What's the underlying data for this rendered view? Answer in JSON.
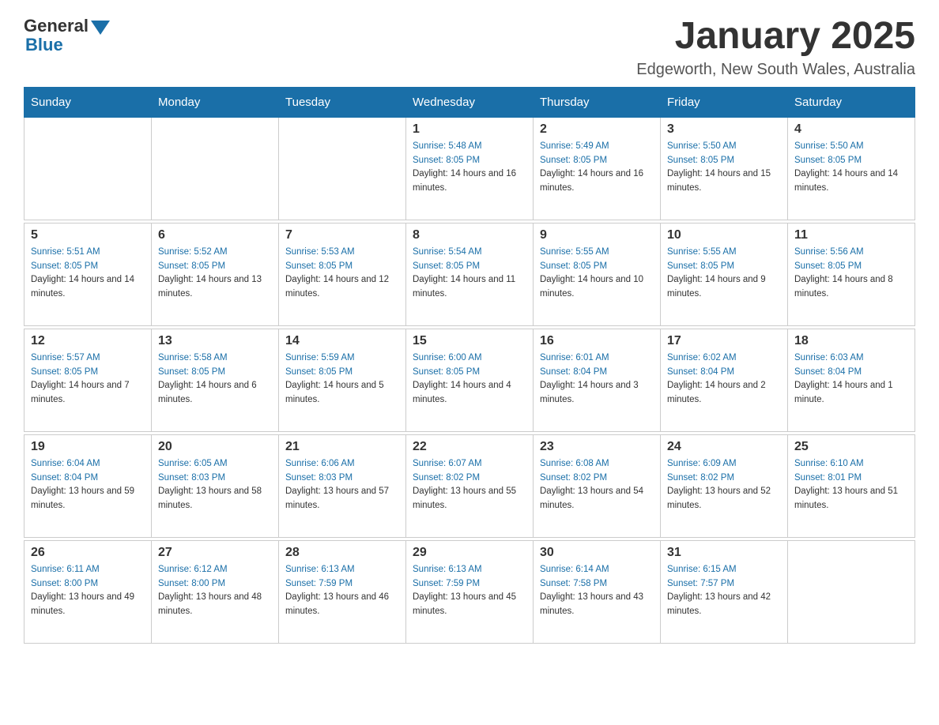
{
  "header": {
    "logo_text": "General",
    "logo_blue": "Blue",
    "month_title": "January 2025",
    "location": "Edgeworth, New South Wales, Australia"
  },
  "days_of_week": [
    "Sunday",
    "Monday",
    "Tuesday",
    "Wednesday",
    "Thursday",
    "Friday",
    "Saturday"
  ],
  "weeks": [
    {
      "days": [
        {
          "num": "",
          "info": ""
        },
        {
          "num": "",
          "info": ""
        },
        {
          "num": "",
          "info": ""
        },
        {
          "num": "1",
          "sunrise": "Sunrise: 5:48 AM",
          "sunset": "Sunset: 8:05 PM",
          "daylight": "Daylight: 14 hours and 16 minutes."
        },
        {
          "num": "2",
          "sunrise": "Sunrise: 5:49 AM",
          "sunset": "Sunset: 8:05 PM",
          "daylight": "Daylight: 14 hours and 16 minutes."
        },
        {
          "num": "3",
          "sunrise": "Sunrise: 5:50 AM",
          "sunset": "Sunset: 8:05 PM",
          "daylight": "Daylight: 14 hours and 15 minutes."
        },
        {
          "num": "4",
          "sunrise": "Sunrise: 5:50 AM",
          "sunset": "Sunset: 8:05 PM",
          "daylight": "Daylight: 14 hours and 14 minutes."
        }
      ]
    },
    {
      "days": [
        {
          "num": "5",
          "sunrise": "Sunrise: 5:51 AM",
          "sunset": "Sunset: 8:05 PM",
          "daylight": "Daylight: 14 hours and 14 minutes."
        },
        {
          "num": "6",
          "sunrise": "Sunrise: 5:52 AM",
          "sunset": "Sunset: 8:05 PM",
          "daylight": "Daylight: 14 hours and 13 minutes."
        },
        {
          "num": "7",
          "sunrise": "Sunrise: 5:53 AM",
          "sunset": "Sunset: 8:05 PM",
          "daylight": "Daylight: 14 hours and 12 minutes."
        },
        {
          "num": "8",
          "sunrise": "Sunrise: 5:54 AM",
          "sunset": "Sunset: 8:05 PM",
          "daylight": "Daylight: 14 hours and 11 minutes."
        },
        {
          "num": "9",
          "sunrise": "Sunrise: 5:55 AM",
          "sunset": "Sunset: 8:05 PM",
          "daylight": "Daylight: 14 hours and 10 minutes."
        },
        {
          "num": "10",
          "sunrise": "Sunrise: 5:55 AM",
          "sunset": "Sunset: 8:05 PM",
          "daylight": "Daylight: 14 hours and 9 minutes."
        },
        {
          "num": "11",
          "sunrise": "Sunrise: 5:56 AM",
          "sunset": "Sunset: 8:05 PM",
          "daylight": "Daylight: 14 hours and 8 minutes."
        }
      ]
    },
    {
      "days": [
        {
          "num": "12",
          "sunrise": "Sunrise: 5:57 AM",
          "sunset": "Sunset: 8:05 PM",
          "daylight": "Daylight: 14 hours and 7 minutes."
        },
        {
          "num": "13",
          "sunrise": "Sunrise: 5:58 AM",
          "sunset": "Sunset: 8:05 PM",
          "daylight": "Daylight: 14 hours and 6 minutes."
        },
        {
          "num": "14",
          "sunrise": "Sunrise: 5:59 AM",
          "sunset": "Sunset: 8:05 PM",
          "daylight": "Daylight: 14 hours and 5 minutes."
        },
        {
          "num": "15",
          "sunrise": "Sunrise: 6:00 AM",
          "sunset": "Sunset: 8:05 PM",
          "daylight": "Daylight: 14 hours and 4 minutes."
        },
        {
          "num": "16",
          "sunrise": "Sunrise: 6:01 AM",
          "sunset": "Sunset: 8:04 PM",
          "daylight": "Daylight: 14 hours and 3 minutes."
        },
        {
          "num": "17",
          "sunrise": "Sunrise: 6:02 AM",
          "sunset": "Sunset: 8:04 PM",
          "daylight": "Daylight: 14 hours and 2 minutes."
        },
        {
          "num": "18",
          "sunrise": "Sunrise: 6:03 AM",
          "sunset": "Sunset: 8:04 PM",
          "daylight": "Daylight: 14 hours and 1 minute."
        }
      ]
    },
    {
      "days": [
        {
          "num": "19",
          "sunrise": "Sunrise: 6:04 AM",
          "sunset": "Sunset: 8:04 PM",
          "daylight": "Daylight: 13 hours and 59 minutes."
        },
        {
          "num": "20",
          "sunrise": "Sunrise: 6:05 AM",
          "sunset": "Sunset: 8:03 PM",
          "daylight": "Daylight: 13 hours and 58 minutes."
        },
        {
          "num": "21",
          "sunrise": "Sunrise: 6:06 AM",
          "sunset": "Sunset: 8:03 PM",
          "daylight": "Daylight: 13 hours and 57 minutes."
        },
        {
          "num": "22",
          "sunrise": "Sunrise: 6:07 AM",
          "sunset": "Sunset: 8:02 PM",
          "daylight": "Daylight: 13 hours and 55 minutes."
        },
        {
          "num": "23",
          "sunrise": "Sunrise: 6:08 AM",
          "sunset": "Sunset: 8:02 PM",
          "daylight": "Daylight: 13 hours and 54 minutes."
        },
        {
          "num": "24",
          "sunrise": "Sunrise: 6:09 AM",
          "sunset": "Sunset: 8:02 PM",
          "daylight": "Daylight: 13 hours and 52 minutes."
        },
        {
          "num": "25",
          "sunrise": "Sunrise: 6:10 AM",
          "sunset": "Sunset: 8:01 PM",
          "daylight": "Daylight: 13 hours and 51 minutes."
        }
      ]
    },
    {
      "days": [
        {
          "num": "26",
          "sunrise": "Sunrise: 6:11 AM",
          "sunset": "Sunset: 8:00 PM",
          "daylight": "Daylight: 13 hours and 49 minutes."
        },
        {
          "num": "27",
          "sunrise": "Sunrise: 6:12 AM",
          "sunset": "Sunset: 8:00 PM",
          "daylight": "Daylight: 13 hours and 48 minutes."
        },
        {
          "num": "28",
          "sunrise": "Sunrise: 6:13 AM",
          "sunset": "Sunset: 7:59 PM",
          "daylight": "Daylight: 13 hours and 46 minutes."
        },
        {
          "num": "29",
          "sunrise": "Sunrise: 6:13 AM",
          "sunset": "Sunset: 7:59 PM",
          "daylight": "Daylight: 13 hours and 45 minutes."
        },
        {
          "num": "30",
          "sunrise": "Sunrise: 6:14 AM",
          "sunset": "Sunset: 7:58 PM",
          "daylight": "Daylight: 13 hours and 43 minutes."
        },
        {
          "num": "31",
          "sunrise": "Sunrise: 6:15 AM",
          "sunset": "Sunset: 7:57 PM",
          "daylight": "Daylight: 13 hours and 42 minutes."
        },
        {
          "num": "",
          "info": ""
        }
      ]
    }
  ]
}
